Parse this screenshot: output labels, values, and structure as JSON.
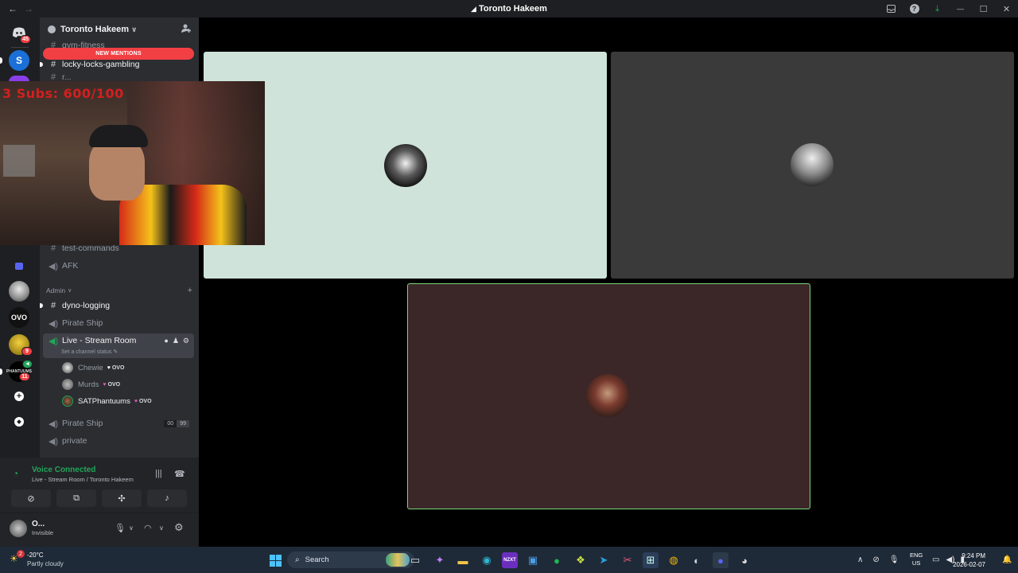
{
  "window": {
    "title": "Toronto Hakeem",
    "nav_back": "←",
    "nav_fwd": "→"
  },
  "titlebar_icons": {
    "inbox": "inbox-icon",
    "help": "?",
    "download": "⤓",
    "minimize": "—",
    "maximize": "☐",
    "close": "✕"
  },
  "rail": {
    "home_badge": "45",
    "badge_9": "9",
    "badge_11": "11"
  },
  "guild": {
    "name": "Toronto Hakeem",
    "new_mentions": "NEW MENTIONS"
  },
  "channels": {
    "partial_top": "gym-fitness",
    "locky": "locky-locks-gambling",
    "partial_3": "r...",
    "test_commands": "test-commands",
    "afk": "AFK",
    "category_admin": "Admin",
    "dyno": "dyno-logging",
    "pirate1": "Pirate Ship",
    "live": "Live - Stream Room",
    "live_status": "Set a channel status",
    "pirate2": "Pirate Ship",
    "pirate2_count_a": "00",
    "pirate2_count_b": "99",
    "private": "private"
  },
  "voice_users": [
    {
      "name": "Chewie",
      "tag": "OVO"
    },
    {
      "name": "Murds",
      "tag": "OVO"
    },
    {
      "name": "SATPhantuums",
      "tag": "OVO"
    }
  ],
  "voice_panel": {
    "status": "Voice Connected",
    "location": "Live - Stream Room / Toronto Hakeem"
  },
  "user_panel": {
    "name": "O...",
    "status": "Invisible"
  },
  "webcam": {
    "overlay_text": "3 Subs: 600/100"
  },
  "colors": {
    "tile1_bg": "#cfe3da",
    "tile2_bg": "#3a3a3a",
    "tile3_bg": "#3b2628",
    "tile3_border": "#7cd67c",
    "accent_green": "#23a55a",
    "mention_red": "#f23f43"
  },
  "taskbar": {
    "weather_temp": "-20°C",
    "weather_cond": "Partly cloudy",
    "weather_badge": "2",
    "search_placeholder": "Search",
    "lang_top": "ENG",
    "lang_bottom": "US",
    "time": "9:24 PM",
    "date": "2026-02-07"
  }
}
